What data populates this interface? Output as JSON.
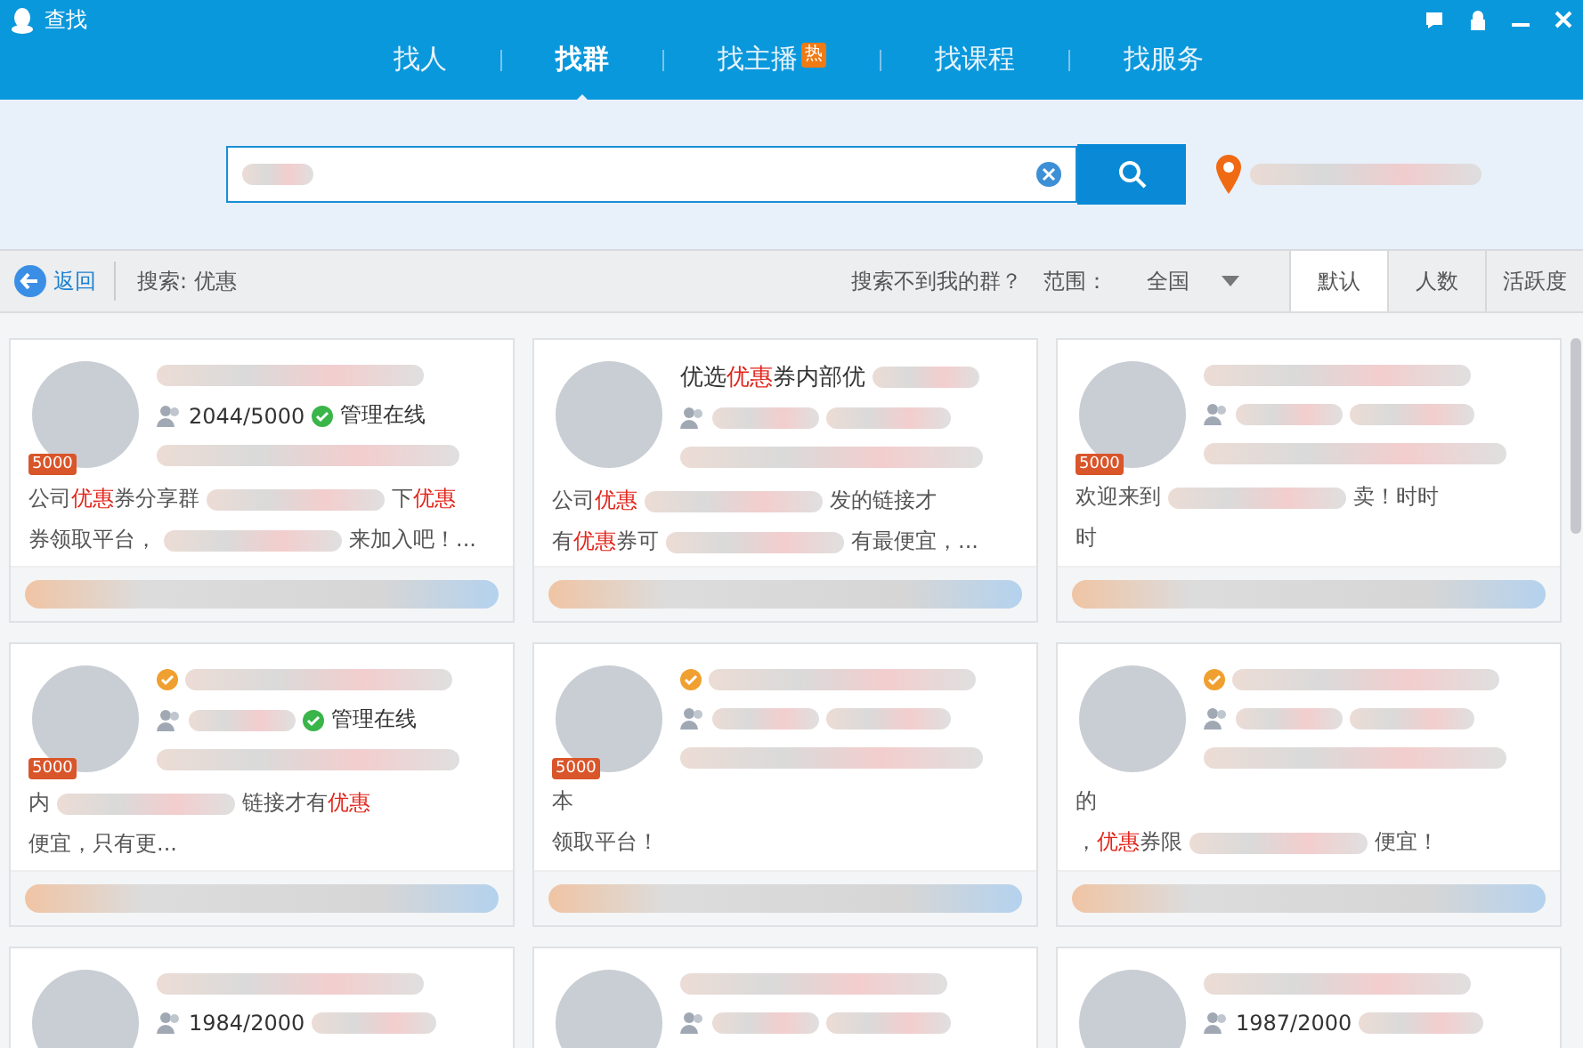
{
  "window": {
    "title": "查找"
  },
  "nav_tabs": [
    {
      "label": "找人",
      "selected": false
    },
    {
      "label": "找群",
      "selected": true
    },
    {
      "label": "找主播",
      "selected": false,
      "badge": "热"
    },
    {
      "label": "找课程",
      "selected": false
    },
    {
      "label": "找服务",
      "selected": false
    }
  ],
  "toolbar": {
    "back": "返回",
    "query": "搜索: 优惠",
    "help_link": "搜索不到我的群？",
    "range_label": "范围：",
    "range_value": "全国",
    "sort_tabs": [
      {
        "label": "默认",
        "selected": true
      },
      {
        "label": "人数",
        "selected": false
      },
      {
        "label": "活跃度",
        "selected": false
      }
    ]
  },
  "groups": [
    {
      "badge": "5000",
      "verified": false,
      "members": "2044/5000",
      "status": "管理在线",
      "desc": [
        [
          "公司**优惠**券分享群",
          "下**优惠**"
        ],
        [
          "券领取平台，",
          "来加入吧！..."
        ]
      ]
    },
    {
      "verified": false,
      "name": [
        "优选**优惠**券内部优"
      ],
      "desc": [
        [
          "公司**优惠**",
          "发的链接才"
        ],
        [
          "有**优惠**券可",
          "有最便宜，..."
        ]
      ]
    },
    {
      "badge": "5000",
      "verified": false,
      "desc": [
        [
          "欢迎来到",
          "卖！时时"
        ],
        [
          "时"
        ]
      ]
    },
    {
      "badge": "5000",
      "verified": true,
      "status": "管理在线",
      "desc": [
        [
          "内",
          "链接才有**优惠**"
        ],
        [
          "便宜，只有更..."
        ]
      ]
    },
    {
      "badge": "5000",
      "verified": true,
      "desc": [
        [
          "本"
        ],
        [
          "领取平台！"
        ]
      ]
    },
    {
      "verified": true,
      "desc": [
        [
          "的"
        ],
        [
          "，**优惠**券限",
          "便宜！"
        ]
      ]
    },
    {
      "verified": false,
      "members": "1984/2000"
    },
    {
      "verified": false
    },
    {
      "verified": false,
      "members": "1987/2000"
    }
  ]
}
